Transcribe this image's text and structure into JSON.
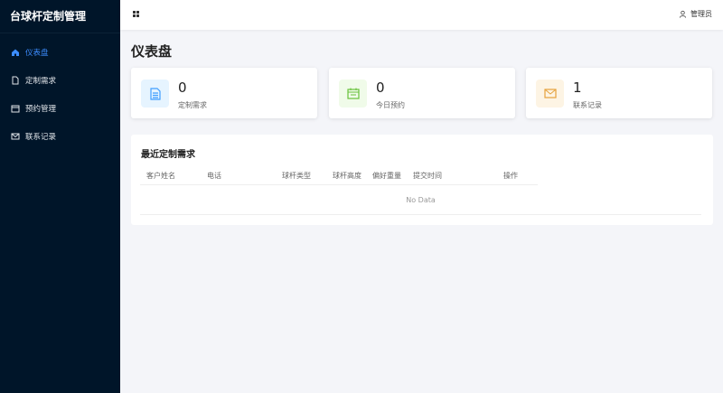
{
  "sidebar": {
    "brand": "台球杆定制管理",
    "items": [
      {
        "label": "仪表盘",
        "icon": "home-icon"
      },
      {
        "label": "定制需求",
        "icon": "document-icon"
      },
      {
        "label": "预约管理",
        "icon": "calendar-icon"
      },
      {
        "label": "联系记录",
        "icon": "mail-icon"
      }
    ]
  },
  "header": {
    "user": "管理员"
  },
  "page": {
    "title": "仪表盘"
  },
  "stats": [
    {
      "value": "0",
      "label": "定制需求",
      "color": "#409eff"
    },
    {
      "value": "0",
      "label": "今日预约",
      "color": "#67c23a"
    },
    {
      "value": "1",
      "label": "联系记录",
      "color": "#e6a23c"
    }
  ],
  "recent": {
    "title": "最近定制需求",
    "columns": [
      "客户姓名",
      "电话",
      "球杆类型",
      "球杆高度",
      "偏好重量",
      "提交时间",
      "操作"
    ],
    "empty": "No Data"
  }
}
